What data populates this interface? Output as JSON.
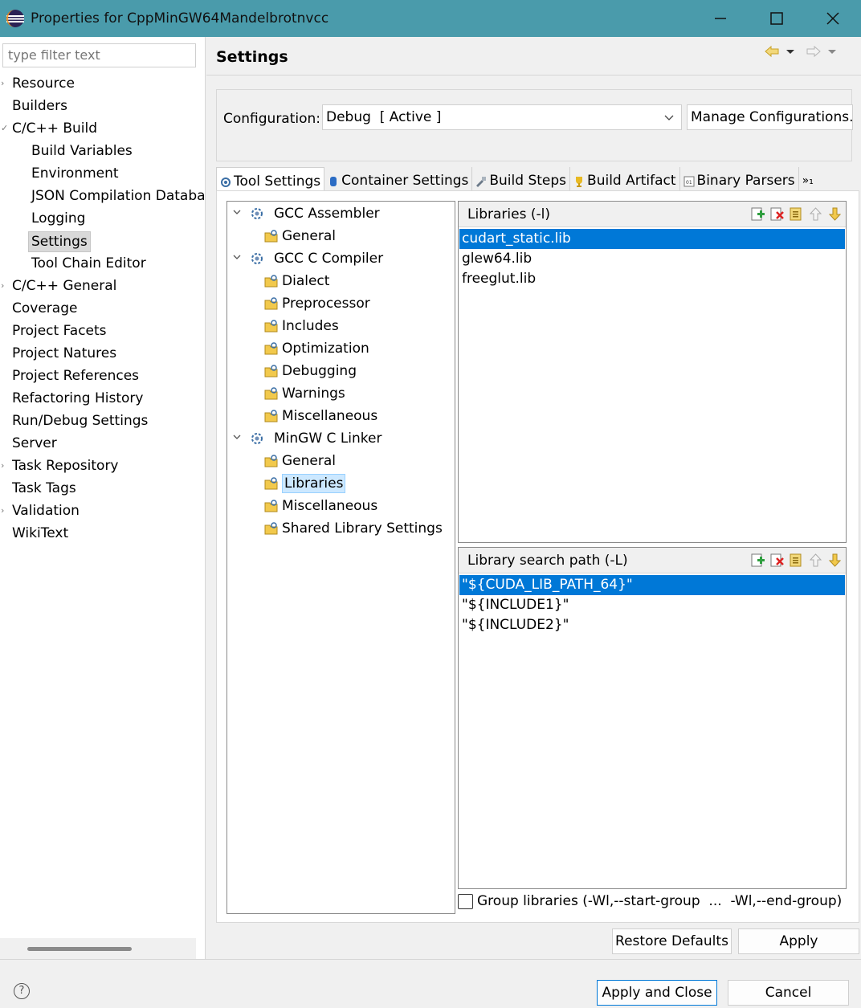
{
  "window": {
    "title": "Properties for CppMinGW64Mandelbrotnvcc"
  },
  "filter": {
    "placeholder": "type filter text"
  },
  "nav": {
    "items": [
      {
        "label": "Resource",
        "arrow": "›",
        "child": false
      },
      {
        "label": "Builders",
        "arrow": "",
        "child": false
      },
      {
        "label": "C/C++ Build",
        "arrow": "✓",
        "child": false
      },
      {
        "label": "Build Variables",
        "arrow": "",
        "child": true
      },
      {
        "label": "Environment",
        "arrow": "",
        "child": true
      },
      {
        "label": "JSON Compilation Databa",
        "arrow": "",
        "child": true
      },
      {
        "label": "Logging",
        "arrow": "",
        "child": true
      },
      {
        "label": "Settings",
        "arrow": "",
        "child": true,
        "selected": true
      },
      {
        "label": "Tool Chain Editor",
        "arrow": "",
        "child": true
      },
      {
        "label": "C/C++ General",
        "arrow": "›",
        "child": false
      },
      {
        "label": "Coverage",
        "arrow": "",
        "child": false
      },
      {
        "label": "Project Facets",
        "arrow": "",
        "child": false
      },
      {
        "label": "Project Natures",
        "arrow": "",
        "child": false
      },
      {
        "label": "Project References",
        "arrow": "",
        "child": false
      },
      {
        "label": "Refactoring History",
        "arrow": "",
        "child": false
      },
      {
        "label": "Run/Debug Settings",
        "arrow": "",
        "child": false
      },
      {
        "label": "Server",
        "arrow": "",
        "child": false
      },
      {
        "label": "Task Repository",
        "arrow": "›",
        "child": false
      },
      {
        "label": "Task Tags",
        "arrow": "",
        "child": false
      },
      {
        "label": "Validation",
        "arrow": "›",
        "child": false
      },
      {
        "label": "WikiText",
        "arrow": "",
        "child": false
      }
    ]
  },
  "page": {
    "title": "Settings"
  },
  "config": {
    "label": "Configuration:",
    "value": "Debug  [ Active ]",
    "manage_label": "Manage Configurations..."
  },
  "tabs": [
    {
      "label": "Tool Settings",
      "icon": "tool-icon",
      "active": true
    },
    {
      "label": "Container Settings",
      "icon": "container-icon"
    },
    {
      "label": "Build Steps",
      "icon": "build-steps-icon"
    },
    {
      "label": "Build Artifact",
      "icon": "trophy-icon"
    },
    {
      "label": "Binary Parsers",
      "icon": "binary-icon"
    }
  ],
  "tabs_overflow": "»₁",
  "tree": {
    "rows": [
      {
        "label": "GCC Assembler",
        "level": 0,
        "expanded": true
      },
      {
        "label": "General",
        "level": 1
      },
      {
        "label": "GCC C Compiler",
        "level": 0,
        "expanded": true
      },
      {
        "label": "Dialect",
        "level": 1
      },
      {
        "label": "Preprocessor",
        "level": 1
      },
      {
        "label": "Includes",
        "level": 1
      },
      {
        "label": "Optimization",
        "level": 1
      },
      {
        "label": "Debugging",
        "level": 1
      },
      {
        "label": "Warnings",
        "level": 1
      },
      {
        "label": "Miscellaneous",
        "level": 1
      },
      {
        "label": "MinGW C Linker",
        "level": 0,
        "expanded": true
      },
      {
        "label": "General",
        "level": 1
      },
      {
        "label": "Libraries",
        "level": 1,
        "selected": true
      },
      {
        "label": "Miscellaneous",
        "level": 1
      },
      {
        "label": "Shared Library Settings",
        "level": 1
      }
    ]
  },
  "libraries": {
    "title": "Libraries (-l)",
    "items": [
      "cudart_static.lib",
      "glew64.lib",
      "freeglut.lib"
    ]
  },
  "search_path": {
    "title": "Library search path (-L)",
    "items": [
      "\"${CUDA_LIB_PATH_64}\"",
      "\"${INCLUDE1}\"",
      "\"${INCLUDE2}\""
    ]
  },
  "group_libraries": {
    "label": "Group libraries (-Wl,--start-group  ...  -Wl,--end-group)",
    "checked": false
  },
  "buttons": {
    "restore_defaults": "Restore Defaults",
    "apply": "Apply",
    "apply_and_close": "Apply and Close",
    "cancel": "Cancel"
  },
  "colors": {
    "titlebar": "#4a9bab",
    "selection": "#0078d7",
    "tree_selection": "#cce8ff"
  }
}
